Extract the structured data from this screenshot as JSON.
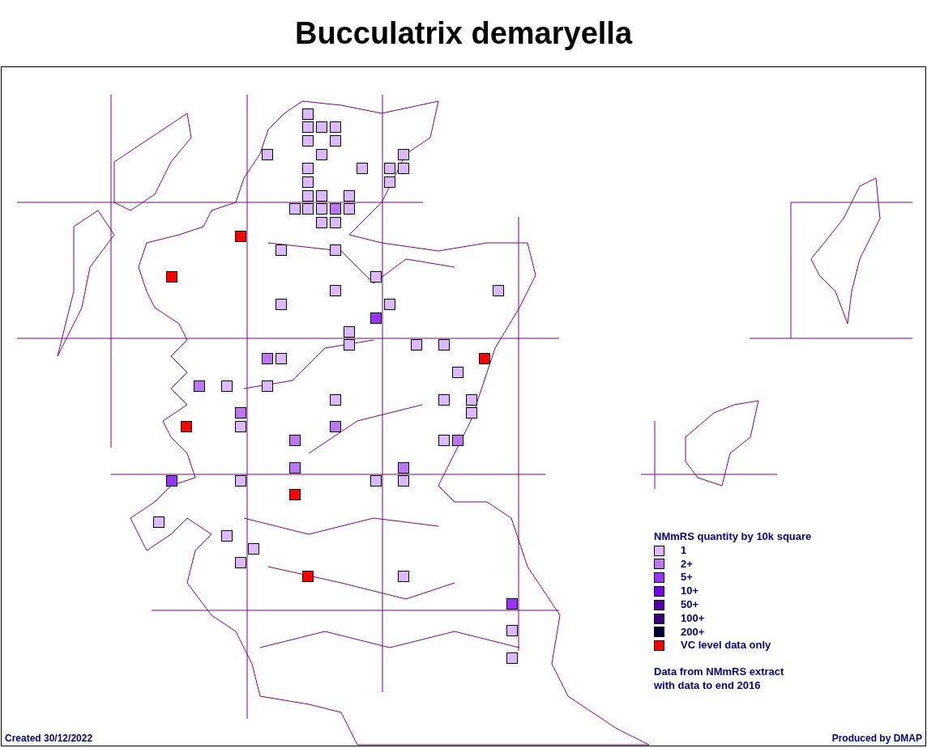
{
  "title": "Bucculatrix demaryella",
  "legend": {
    "heading": "NMmRS quantity by 10k square",
    "items": [
      {
        "label": "1",
        "color": "#dcb9fa"
      },
      {
        "label": "2+",
        "color": "#bb77f2"
      },
      {
        "label": "5+",
        "color": "#9933ff"
      },
      {
        "label": "10+",
        "color": "#7700ee"
      },
      {
        "label": "50+",
        "color": "#5500aa"
      },
      {
        "label": "100+",
        "color": "#40007f"
      },
      {
        "label": "200+",
        "color": "#000040"
      },
      {
        "label": "VC level data only",
        "color": "#ff0000"
      }
    ],
    "note": [
      "Data from NMmRS extract",
      "with data to end 2016"
    ]
  },
  "footer": {
    "created": "Created 30/12/2022",
    "produced": "Produced by DMAP"
  }
}
